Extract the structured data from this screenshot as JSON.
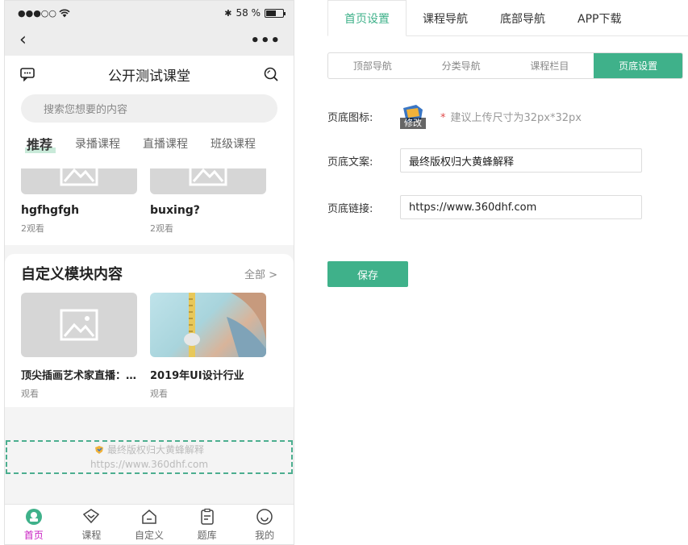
{
  "phone": {
    "status": {
      "battery_percent": "58 %",
      "battery_level": 0.58
    },
    "site_title": "公开测试课堂",
    "search_placeholder": "搜索您想要的内容",
    "categories": [
      "推荐",
      "录播课程",
      "直播课程",
      "班级课程"
    ],
    "list_cards": [
      {
        "title": "hgfhgfgh",
        "views": "2观看"
      },
      {
        "title": "buxing?",
        "views": "2观看"
      }
    ],
    "custom_block": {
      "title": "自定义模块内容",
      "all_label": "全部 >",
      "cards": [
        {
          "title": "顶尖插画艺术家直播：...",
          "views": "观看"
        },
        {
          "title": "2019年UI设计行业",
          "views": "观看"
        }
      ]
    },
    "footer": {
      "text": "最终版权归大黄蜂解释",
      "link": "https://www.360dhf.com"
    },
    "tabbar": [
      "首页",
      "课程",
      "自定义",
      "题库",
      "我的"
    ]
  },
  "panel": {
    "top_tabs": [
      "首页设置",
      "课程导航",
      "底部导航",
      "APP下载"
    ],
    "sub_tabs": [
      "顶部导航",
      "分类导航",
      "课程栏目",
      "页底设置"
    ],
    "icon_label": "页底图标:",
    "icon_text": "修改",
    "icon_hint": "建议上传尺寸为32px*32px",
    "text_label": "页底文案:",
    "text_value": "最终版权归大黄蜂解释",
    "link_label": "页底链接:",
    "link_value": "https://www.360dhf.com",
    "save_label": "保存"
  },
  "colors": {
    "accent": "#3fb18a",
    "tab_active": "#c81ec2",
    "footer_border": "#4cae8f"
  }
}
